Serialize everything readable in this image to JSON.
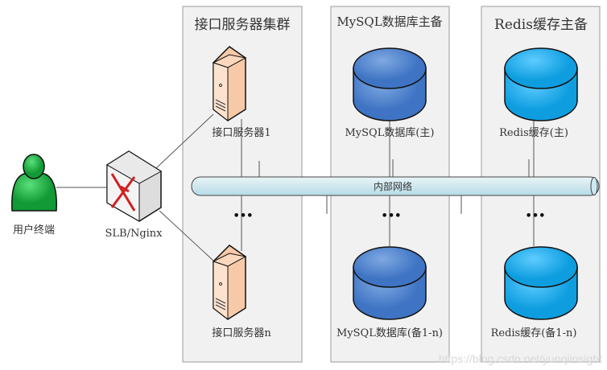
{
  "groups": [
    {
      "title": "接口服务器集群",
      "top_label": "接口服务器1",
      "bottom_label": "接口服务器n"
    },
    {
      "title": "MySQL数据库主备",
      "top_label": "MySQL数据库(主)",
      "bottom_label": "MySQL数据库(备1-n)"
    },
    {
      "title": "Redis缓存主备",
      "top_label": "Redis缓存(主)",
      "bottom_label": "Redis缓存(备1-n)"
    }
  ],
  "network_label": "内部网络",
  "user_label": "用户终端",
  "lb_label": "SLB/Nginx",
  "ellipsis": "•••",
  "watermark": "https://blog.csdn.net/yunqiinsight",
  "colors": {
    "server": "#fbd7bd",
    "mysql": "#4f86d0",
    "redis": "#1aa7e8",
    "user": "#22b24a",
    "pipe": "#cde8ef",
    "panel": "#f1f1f1"
  }
}
